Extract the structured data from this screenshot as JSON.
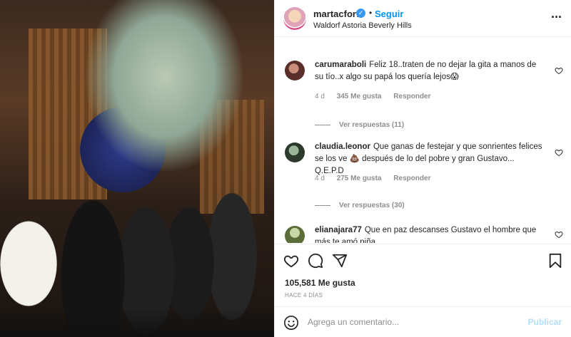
{
  "post": {
    "username": "martacfort",
    "verified_icon": "verified-badge-icon",
    "separator": "•",
    "follow_label": "Seguir",
    "location": "Waldorf Astoria Beverly Hills",
    "more_icon": "more-options-icon",
    "more_glyph": "···"
  },
  "comments": [
    {
      "user": "carumaraboli",
      "text": "Feliz 18..traten de no dejar la gita a manos de su tío..x algo su papá los quería lejos😱",
      "age": "4 d",
      "likes": "345 Me gusta",
      "reply_label": "Responder",
      "view_replies": "Ver respuestas (11)"
    },
    {
      "user": "claudia.leonor",
      "text": "Que ganas de festejar y que sonrientes felices se los ve 💩 después de lo del pobre y gran Gustavo... Q.E.P.D",
      "age": "4 d",
      "likes": "275 Me gusta",
      "reply_label": "Responder",
      "view_replies": "Ver respuestas (30)"
    },
    {
      "user": "elianajara77",
      "text": "Que en paz descanses Gustavo el hombre que más te amó piña"
    }
  ],
  "actions": {
    "like_icon": "heart-icon",
    "comment_icon": "comment-icon",
    "share_icon": "share-icon",
    "save_icon": "bookmark-icon"
  },
  "likes_count": "105,581 Me gusta",
  "time_ago": "HACE 4 DÍAS",
  "add_comment": {
    "placeholder": "Agrega un comentario...",
    "post_label": "Publicar",
    "emoji_icon": "emoji-icon"
  },
  "colors": {
    "accent": "#0095f6",
    "text": "#262626",
    "muted": "#8e8e8e",
    "border": "#efefef",
    "post_disabled": "#b2dffc"
  }
}
